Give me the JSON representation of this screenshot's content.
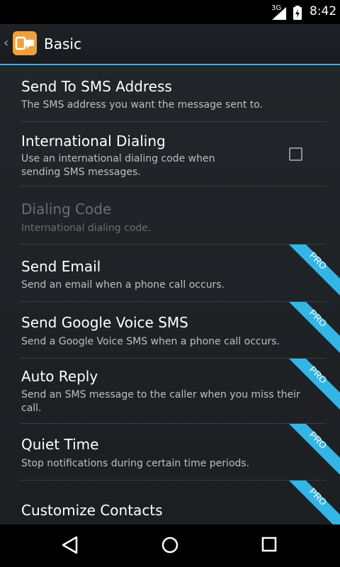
{
  "status_bar": {
    "network": "3G",
    "time": "8:42"
  },
  "action_bar": {
    "title": "Basic"
  },
  "preferences": [
    {
      "title": "Send To SMS Address",
      "summary": "The SMS address you want the message sent to."
    },
    {
      "title": "International Dialing",
      "summary": "Use an international dialing code when sending SMS messages.",
      "checked": false
    },
    {
      "title": "Dialing Code",
      "summary": "International dialing code.",
      "enabled": false
    },
    {
      "title": "Send Email",
      "summary": "Send an email when a phone call occurs.",
      "badge": "PRO"
    },
    {
      "title": "Send Google Voice SMS",
      "summary": "Send a Google Voice SMS when a phone call occurs.",
      "badge": "PRO"
    },
    {
      "title": "Auto Reply",
      "summary": "Send an SMS message to the caller when you miss their call.",
      "badge": "PRO"
    },
    {
      "title": "Quiet Time",
      "summary": "Stop notifications during certain time periods.",
      "badge": "PRO"
    },
    {
      "title": "Customize Contacts",
      "summary": "",
      "badge": "PRO"
    }
  ],
  "colors": {
    "accent": "#33b5e5",
    "ribbon": "#33b5e5",
    "app_icon": "#f0a03a"
  },
  "icons": {
    "back": "chevron-left-icon",
    "app": "app-icon",
    "signal": "signal-icon",
    "battery": "battery-icon",
    "nav_back": "back-icon",
    "nav_home": "home-icon",
    "nav_recents": "recents-icon"
  }
}
